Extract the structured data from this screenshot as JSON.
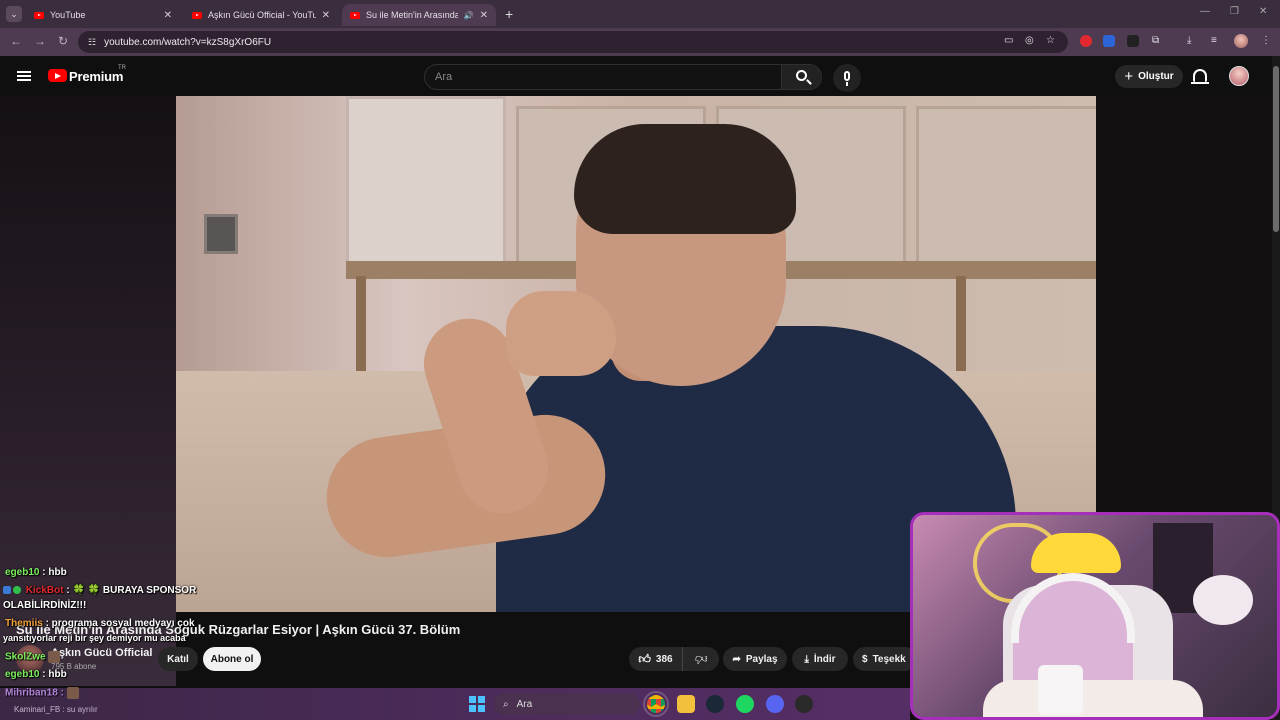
{
  "browser": {
    "tabs": [
      {
        "label": "YouTube",
        "active": false
      },
      {
        "label": "Aşkın Gücü Official - YouTube",
        "active": false
      },
      {
        "label": "Su ile Metin'in Arasında Soğuk",
        "active": true
      }
    ],
    "url": "youtube.com/watch?v=kzS8gXrO6FU"
  },
  "masthead": {
    "brand": "Premium",
    "region": "TR",
    "search_placeholder": "Ara",
    "create_label": "Oluştur"
  },
  "video": {
    "title": "Su ile Metin'in Arasında Soğuk Rüzgarlar Esiyor | Aşkın Gücü 37. Bölüm",
    "channel": "Aşkın Gücü Official",
    "subscribers": "795 B abone",
    "join_label": "Katıl",
    "subscribe_label": "Abone ol",
    "likes": "386",
    "share_label": "Paylaş",
    "download_label": "İndir",
    "thanks_label": "Teşekk"
  },
  "chat": [
    {
      "user": "egeb10",
      "text": ": hbb",
      "user_color": "#7cf05c"
    },
    {
      "user": "KickBot",
      "text": ": 🍀 🍀 BURAYA SPONSOR",
      "user_color": "#e2282f"
    },
    {
      "user": "",
      "text": "OLABİLİRDİNİZ!!!",
      "user_color": "#ffffff"
    },
    {
      "user": "Themiis",
      "text": ": programa sosyal medyayı çok",
      "user_color": "#f2a33a"
    },
    {
      "user": "",
      "text": "yansıtıyorlar reji bir şey demiyor mu acaba",
      "user_color": "#ffffff"
    },
    {
      "user": "SkolZwe",
      "text": "",
      "user_color": "#7cf05c"
    },
    {
      "user": "egeb10",
      "text": ": hbb",
      "user_color": "#7cf05c"
    },
    {
      "user": "Mihriban18",
      "text": ":",
      "user_color": "#b184d9"
    }
  ],
  "stream_footer": {
    "user": "Kaminari_FB",
    "text": ": su ayrılır"
  },
  "taskbar": {
    "search_placeholder": "Ara"
  },
  "icons": {
    "tab_favicon": "youtube-icon",
    "search": "search-icon",
    "mic": "mic-icon",
    "notifications": "bell-icon",
    "like": "thumbs-up-icon",
    "dislike": "thumbs-down-icon",
    "share": "share-icon",
    "download": "download-icon",
    "thanks": "thanks-icon",
    "start": "windows-start-icon"
  },
  "colors": {
    "brand_red": "#ff0000",
    "tab_bar": "#3a2d3d",
    "address_bar": "#4e3b52",
    "webcam_border": "#a52fb8",
    "taskbar": "#4c2b5a"
  }
}
